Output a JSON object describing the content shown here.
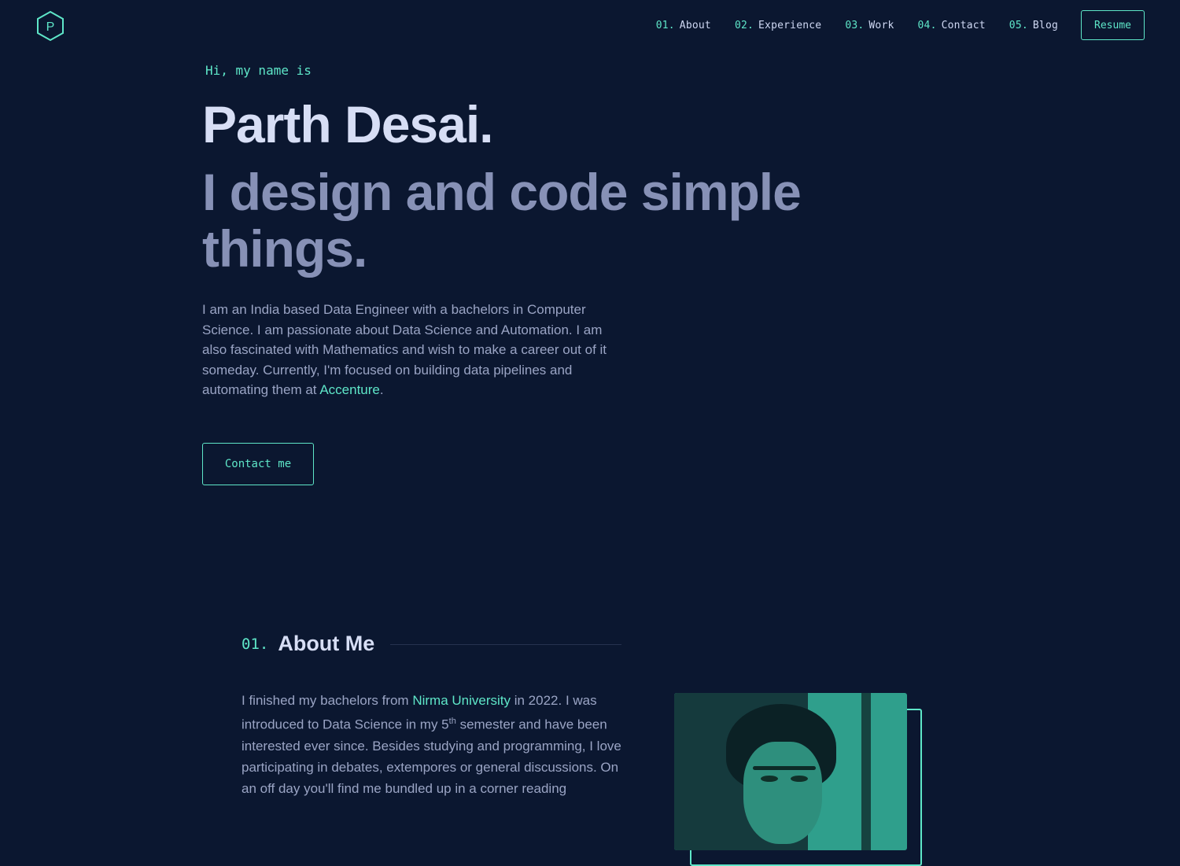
{
  "nav": {
    "logo_letter": "P",
    "links": [
      {
        "num": "01.",
        "label": "About"
      },
      {
        "num": "02.",
        "label": "Experience"
      },
      {
        "num": "03.",
        "label": "Work"
      },
      {
        "num": "04.",
        "label": "Contact"
      },
      {
        "num": "05.",
        "label": "Blog"
      }
    ],
    "resume_label": "Resume"
  },
  "hero": {
    "greeting": "Hi, my name is",
    "name": "Parth Desai.",
    "tagline": "I design and code simple things.",
    "bio_part1": "I am an India based Data Engineer with a bachelors in Computer Science. I am passionate about Data Science and Automation. I am also fascinated with Mathematics and wish to make a career out of it someday. Currently, I'm focused on building data pipelines and automating them at ",
    "bio_link": "Accenture",
    "bio_end": ".",
    "contact_label": "Contact me"
  },
  "about": {
    "num": "01.",
    "title": "About Me",
    "text_part1": "I finished my bachelors from ",
    "link": "Nirma University",
    "text_part2": " in 2022. I was introduced to Data Science in my 5",
    "sup": "th",
    "text_part3": " semester and have been interested ever since. Besides studying and programming, I love participating in debates, extempores or general discussions. On an off day you'll find me bundled up in a corner reading"
  },
  "colors": {
    "background": "#0b1730",
    "accent": "#5ee6c8",
    "heading": "#d7def5",
    "muted": "#8791b6",
    "body_text": "#9aa4c4"
  },
  "icons": {
    "logo": "hexagon-logo-icon"
  }
}
